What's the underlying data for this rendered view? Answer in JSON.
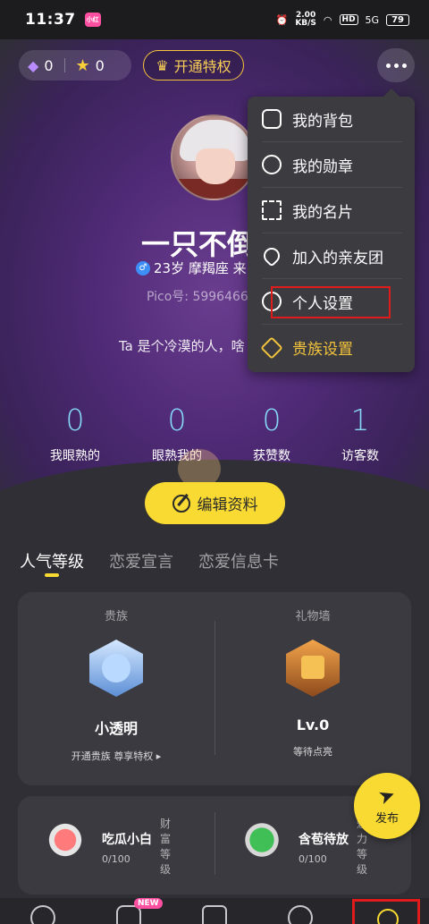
{
  "status_bar": {
    "time": "11:37",
    "app_badge": "小红",
    "net_speed_value": "2.00",
    "net_speed_unit": "KB/S",
    "hd": "HD",
    "signal": "5G",
    "battery": "79"
  },
  "header": {
    "diamond_count": "0",
    "star_count": "0",
    "vip_label": "开通特权"
  },
  "profile": {
    "nickname": "一只不倒",
    "gender_symbol": "♂",
    "info": "23岁 摩羯座 来",
    "pico_id": "Pico号: 5996466",
    "bio": "Ta 是个冷漠的人，啥"
  },
  "stats": [
    {
      "value": "0",
      "label": "我眼熟的"
    },
    {
      "value": "0",
      "label": "眼熟我的"
    },
    {
      "value": "0",
      "label": "获赞数"
    },
    {
      "value": "1",
      "label": "访客数"
    }
  ],
  "edit_button": "编辑资料",
  "tabs": [
    {
      "label": "人气等级",
      "active": true
    },
    {
      "label": "恋爱宣言",
      "active": false
    },
    {
      "label": "恋爱信息卡",
      "active": false
    }
  ],
  "noble_card": {
    "left": {
      "head": "贵族",
      "title": "小透明",
      "sub": "开通贵族 尊享特权 ▸"
    },
    "right": {
      "head": "礼物墙",
      "title": "Lv.0",
      "sub": "等待点亮"
    }
  },
  "levels": {
    "wealth": {
      "label": "财富等级",
      "name": "吃瓜小白",
      "progress": "0/100"
    },
    "charm": {
      "label": "魅力等级",
      "name": "含苞待放",
      "progress": "0/100"
    }
  },
  "publish_label": "发布",
  "nav": {
    "new_badge": "NEW"
  },
  "menu": {
    "items": [
      {
        "label": "我的背包",
        "icon": "backpack-icon"
      },
      {
        "label": "我的勋章",
        "icon": "medal-icon"
      },
      {
        "label": "我的名片",
        "icon": "qr-card-icon"
      },
      {
        "label": "加入的亲友团",
        "icon": "heart-group-icon"
      },
      {
        "label": "个人设置",
        "icon": "settings-hexagon-icon",
        "highlighted": true
      },
      {
        "label": "贵族设置",
        "icon": "noble-diamond-icon",
        "color": "#f3c33b"
      }
    ]
  },
  "colors": {
    "accent_yellow": "#f8da32",
    "stat_blue": "#86d7f5",
    "highlight_red": "#e01b1b"
  }
}
